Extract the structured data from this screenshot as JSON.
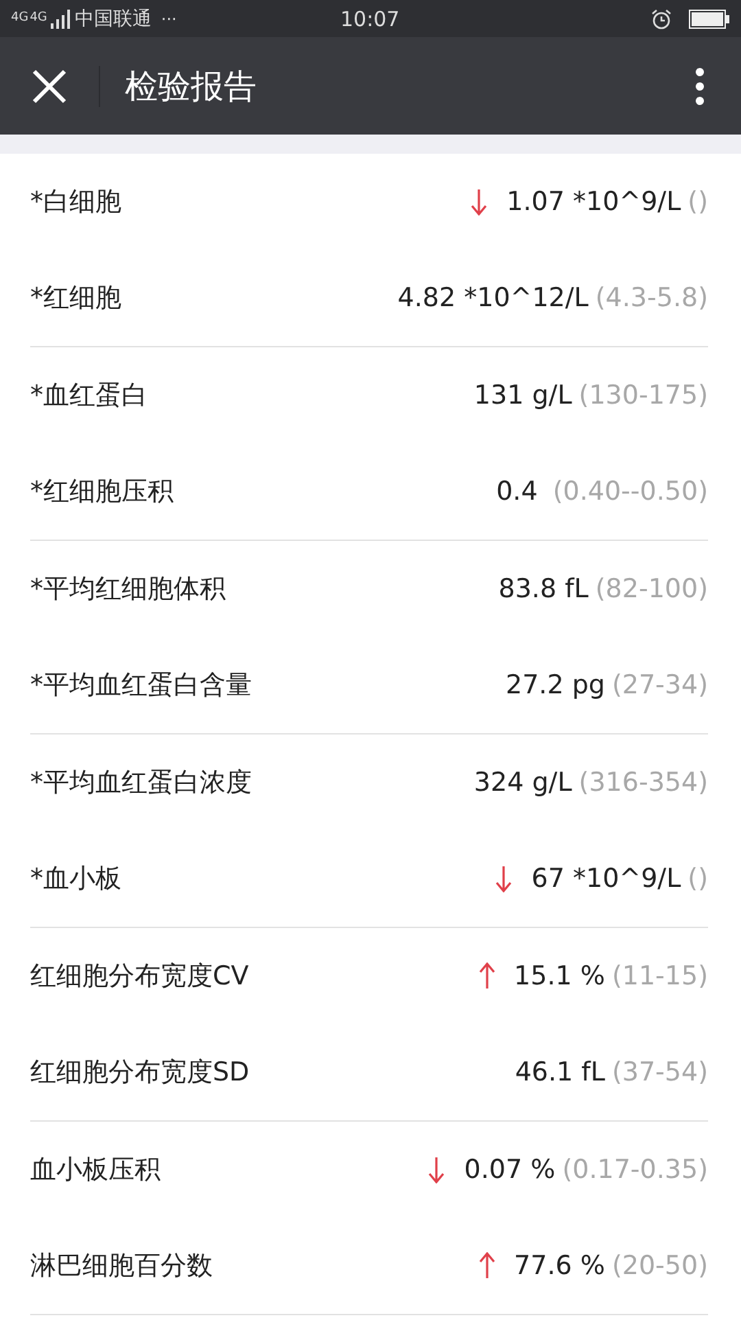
{
  "status_bar": {
    "network": [
      "4G",
      "4G"
    ],
    "carrier": "中国联通",
    "more": "···",
    "time": "10:07"
  },
  "toolbar": {
    "title": "检验报告"
  },
  "groups": [
    {
      "items": [
        {
          "name": "*白细胞",
          "kind": "low",
          "value": "1.07 *10^9/L",
          "range": "()"
        },
        {
          "name": "*红细胞",
          "kind": "normal",
          "value": "4.82 *10^12/L",
          "range": "(4.3-5.8)"
        }
      ]
    },
    {
      "items": [
        {
          "name": "*血红蛋白",
          "kind": "normal",
          "value": "131 g/L",
          "range": "(130-175)"
        },
        {
          "name": "*红细胞压积",
          "kind": "normal",
          "value": "0.4 ",
          "range": "(0.40--0.50)"
        }
      ]
    },
    {
      "items": [
        {
          "name": "*平均红细胞体积",
          "kind": "normal",
          "value": "83.8 fL",
          "range": "(82-100)"
        },
        {
          "name": "*平均血红蛋白含量",
          "kind": "normal",
          "value": "27.2 pg",
          "range": "(27-34)"
        }
      ]
    },
    {
      "items": [
        {
          "name": "*平均血红蛋白浓度",
          "kind": "normal",
          "value": "324 g/L",
          "range": "(316-354)"
        },
        {
          "name": "*血小板",
          "kind": "low",
          "value": "67 *10^9/L",
          "range": "()"
        }
      ]
    },
    {
      "items": [
        {
          "name": "红细胞分布宽度CV",
          "kind": "high",
          "value": "15.1 %",
          "range": "(11-15)"
        },
        {
          "name": "红细胞分布宽度SD",
          "kind": "normal",
          "value": "46.1 fL",
          "range": "(37-54)"
        }
      ]
    },
    {
      "items": [
        {
          "name": "血小板压积",
          "kind": "low",
          "value": "0.07 %",
          "range": "(0.17-0.35)"
        },
        {
          "name": "淋巴细胞百分数",
          "kind": "high",
          "value": "77.6 %",
          "range": "(20-50)"
        }
      ]
    }
  ]
}
